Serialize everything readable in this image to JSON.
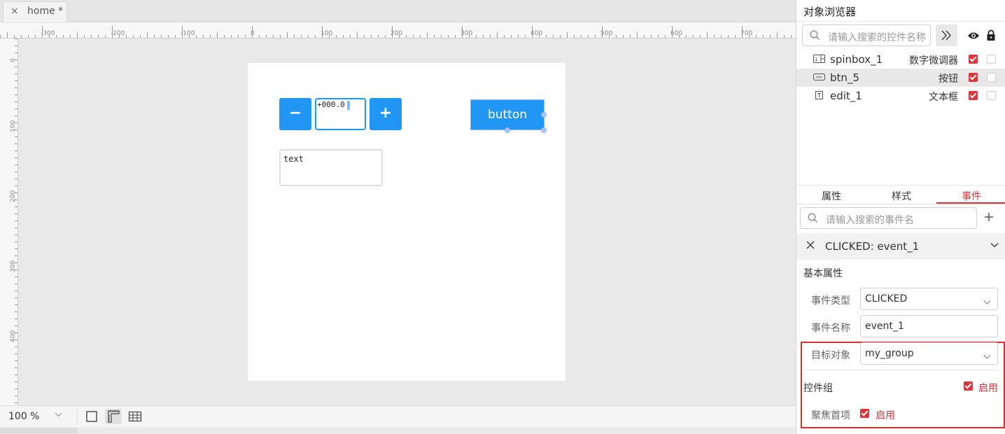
{
  "editor": {
    "tab": {
      "close_glyph": "×",
      "title": "home *"
    },
    "ruler": {
      "h_labels": [
        "-300",
        "-200",
        "-100",
        "0",
        "100",
        "200",
        "300",
        "400",
        "500",
        "600",
        "700"
      ],
      "v_labels": [
        "0",
        "100",
        "200",
        "300",
        "400"
      ]
    },
    "screen": {
      "spinbox": {
        "minus": "−",
        "plus": "+",
        "value": "+000.0"
      },
      "button_label": "button",
      "edit_text": "text"
    },
    "status": {
      "zoom": "100 %"
    }
  },
  "object_browser": {
    "title": "对象浏览器",
    "search_placeholder": "请输入搜索的控件名称",
    "items": [
      {
        "name": "spinbox_1",
        "type": "数字微调器",
        "icon": "spinbox-icon",
        "visible": true,
        "locked": false
      },
      {
        "name": "btn_5",
        "type": "按钮",
        "icon": "button-icon",
        "visible": true,
        "locked": false
      },
      {
        "name": "edit_1",
        "type": "文本框",
        "icon": "textbox-icon",
        "visible": true,
        "locked": false
      }
    ]
  },
  "inspector": {
    "tabs": [
      "属性",
      "样式",
      "事件"
    ],
    "active_tab": "事件",
    "event_search_placeholder": "请输入搜索的事件名",
    "event_header": "CLICKED: event_1",
    "section_title": "基本属性",
    "event_type_label": "事件类型",
    "event_type_value": "CLICKED",
    "event_name_label": "事件名称",
    "event_name_value": "event_1",
    "target_label": "目标对象",
    "target_value": "my_group",
    "group_label": "控件组",
    "group_enable": "启用",
    "focus_label": "聚焦首项",
    "focus_enable": "启用"
  },
  "colors": {
    "accent_blue": "#2196f3",
    "accent_red": "#d9363e",
    "highlight_box": "#d32f2f"
  }
}
